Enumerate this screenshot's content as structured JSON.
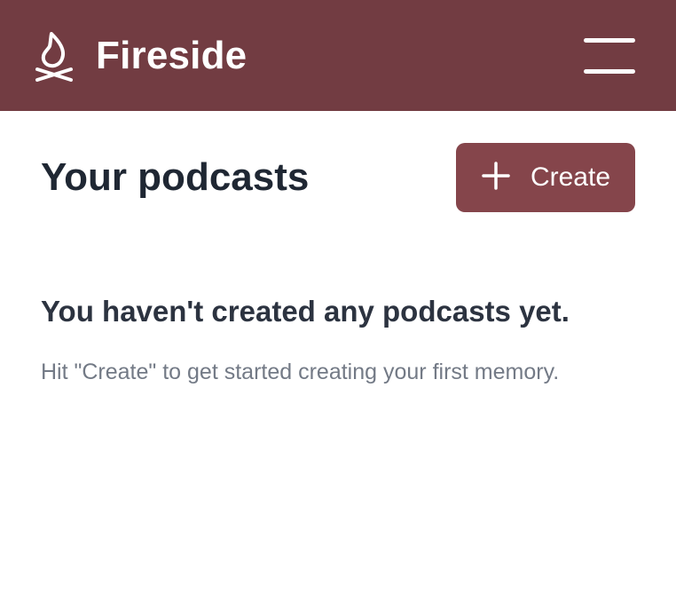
{
  "app": {
    "name": "Fireside"
  },
  "header": {
    "logo_icon": "campfire-icon",
    "menu_icon": "hamburger-menu-icon",
    "background": "#723c42"
  },
  "main": {
    "title": "Your podcasts",
    "create_button": {
      "label": "Create",
      "icon": "plus-icon",
      "color": "#85454b"
    },
    "empty_state": {
      "title": "You haven't created any podcasts yet.",
      "description": "Hit \"Create\" to get started creating your first memory."
    }
  }
}
